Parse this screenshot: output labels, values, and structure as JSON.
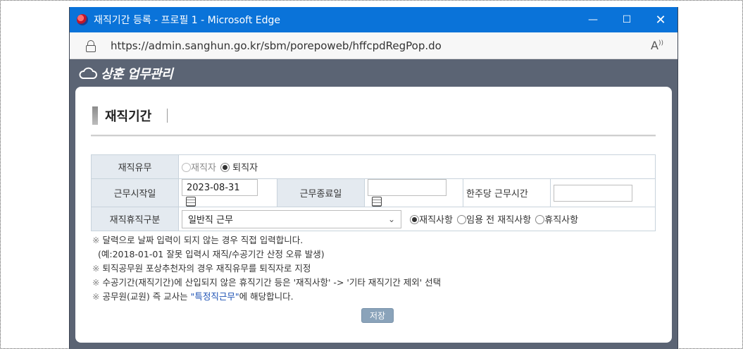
{
  "window": {
    "title": "재직기간 등록 - 프로필 1 - Microsoft Edge",
    "controls": {
      "minimize": "—",
      "maximize": "☐",
      "close": "✕"
    }
  },
  "address_bar": {
    "url": "https://admin.sanghun.go.kr/sbm/porepoweb/hffcpdRegPop.do",
    "read_aloud": "Á"
  },
  "site": {
    "title": "상훈 업무관리"
  },
  "page": {
    "title": "재직기간"
  },
  "form": {
    "employment_status": {
      "label": "재직유무",
      "options": [
        "재직자",
        "퇴직자"
      ],
      "selected": "퇴직자"
    },
    "start_date": {
      "label": "근무시작일",
      "value": "2023-08-31"
    },
    "end_date": {
      "label": "근무종료일",
      "value": ""
    },
    "weekly_hours": {
      "label": "한주당 근무시간",
      "value": ""
    },
    "work_type": {
      "label": "재직휴직구분",
      "selected_value": "일반직 근무",
      "options": [
        "재직사항",
        "임용 전 재직사항",
        "휴직사항"
      ],
      "selected_option": "재직사항"
    }
  },
  "notes": [
    {
      "mark": "※",
      "text": "달력으로 날짜 입력이 되지 않는 경우 직접 입력합니다."
    },
    {
      "mark": "",
      "text": "(예:2018-01-01 잘못 입력시 재직/수공기간 산정 오류 발생)"
    },
    {
      "mark": "※",
      "text": "퇴직공무원 포상추천자의 경우 재직유무를 퇴직자로 지정"
    },
    {
      "mark": "※",
      "text": "수공기간(재직기간)에 산입되지 않은 휴직기간 등은 '재직사항' -> '기타 재직기간 제외' 선택"
    }
  ],
  "note_last": {
    "mark": "※",
    "before": "공무원(교원) 즉 교사는 ",
    "link": "\"특정직근무\"",
    "after": "에 해당합니다."
  },
  "save_button": "저장",
  "colors": {
    "titlebar": "#0a73d9",
    "header": "#5b6474",
    "label_cell": "#e4eaf0",
    "save_button": "#8aa3ba"
  }
}
